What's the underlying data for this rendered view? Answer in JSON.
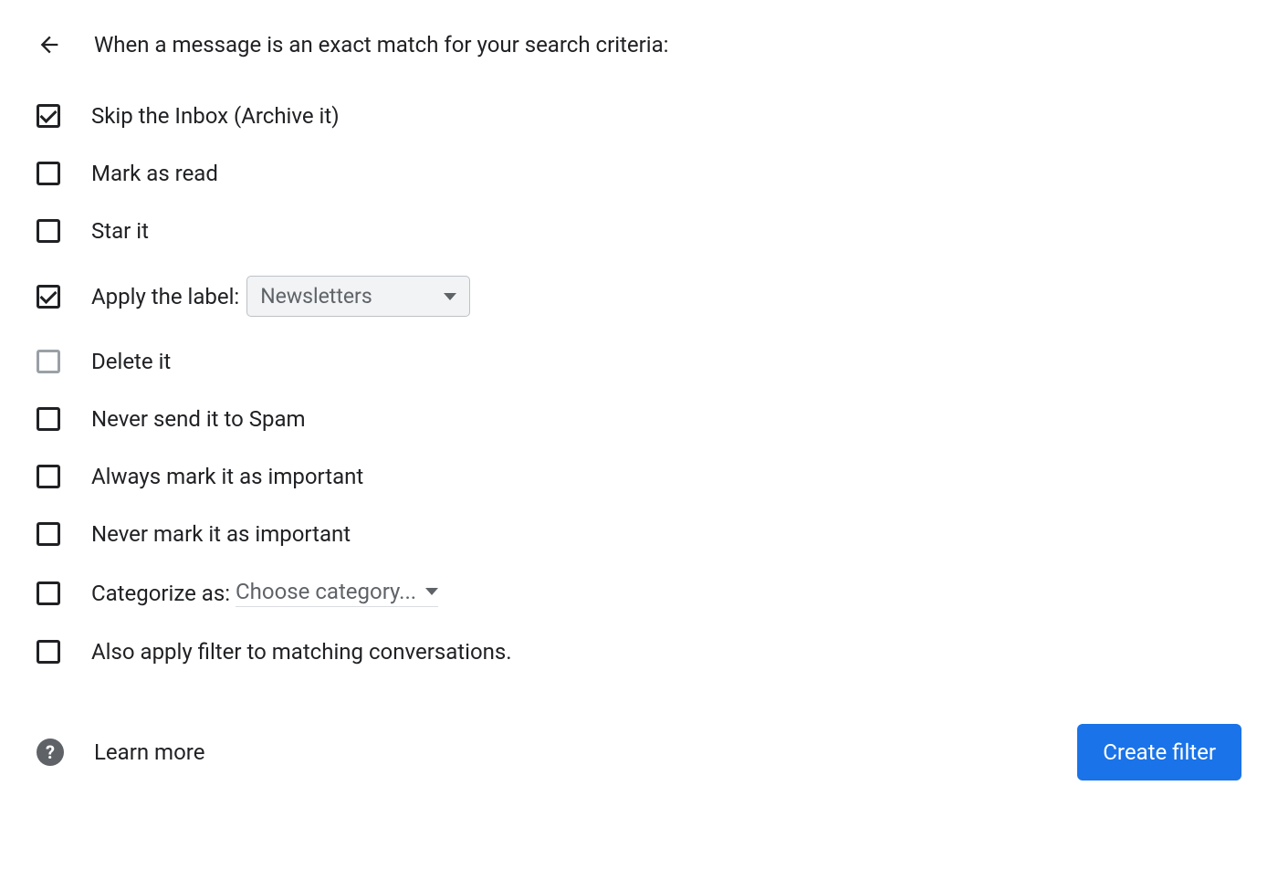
{
  "header": {
    "title": "When a message is an exact match for your search criteria:"
  },
  "options": {
    "skip_inbox": {
      "label": "Skip the Inbox (Archive it)",
      "checked": true
    },
    "mark_as_read": {
      "label": "Mark as read",
      "checked": false
    },
    "star_it": {
      "label": "Star it",
      "checked": false
    },
    "apply_label": {
      "label": "Apply the label:",
      "checked": true,
      "selected_value": "Newsletters"
    },
    "delete_it": {
      "label": "Delete it",
      "checked": false,
      "disabled": true
    },
    "never_spam": {
      "label": "Never send it to Spam",
      "checked": false
    },
    "always_important": {
      "label": "Always mark it as important",
      "checked": false
    },
    "never_important": {
      "label": "Never mark it as important",
      "checked": false
    },
    "categorize": {
      "label": "Categorize as:",
      "checked": false,
      "selected_value": "Choose category..."
    },
    "also_apply": {
      "label": "Also apply filter to matching conversations.",
      "checked": false
    }
  },
  "footer": {
    "help_symbol": "?",
    "learn_more": "Learn more",
    "create_button": "Create filter"
  }
}
